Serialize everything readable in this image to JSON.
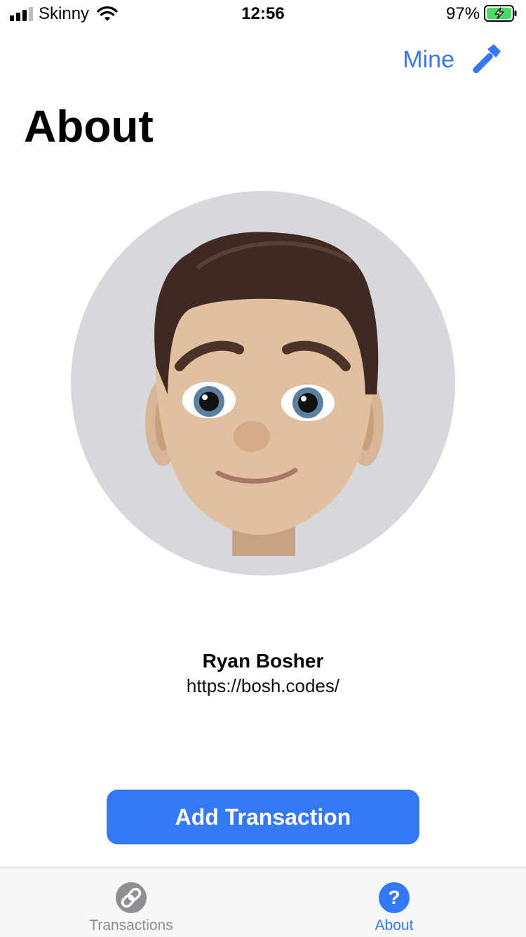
{
  "status_bar": {
    "carrier": "Skinny",
    "time": "12:56",
    "battery_percent": "97%",
    "icons": [
      "signal-icon",
      "wifi-icon",
      "battery-charging-icon"
    ]
  },
  "nav": {
    "right_label": "Mine",
    "right_icon": "hammer-icon",
    "title": "About"
  },
  "profile": {
    "avatar": "memoji-avatar",
    "name": "Ryan Bosher",
    "url": "https://bosh.codes/"
  },
  "actions": {
    "add_transaction_label": "Add Transaction"
  },
  "tab_bar": {
    "tabs": [
      {
        "label": "Transactions",
        "icon": "link-icon",
        "selected": false
      },
      {
        "label": "About",
        "icon": "question-icon",
        "selected": true
      }
    ]
  },
  "colors": {
    "accent": "#3478f6",
    "inactive": "#8e8e93",
    "avatar_background": "#d7d8dc"
  }
}
